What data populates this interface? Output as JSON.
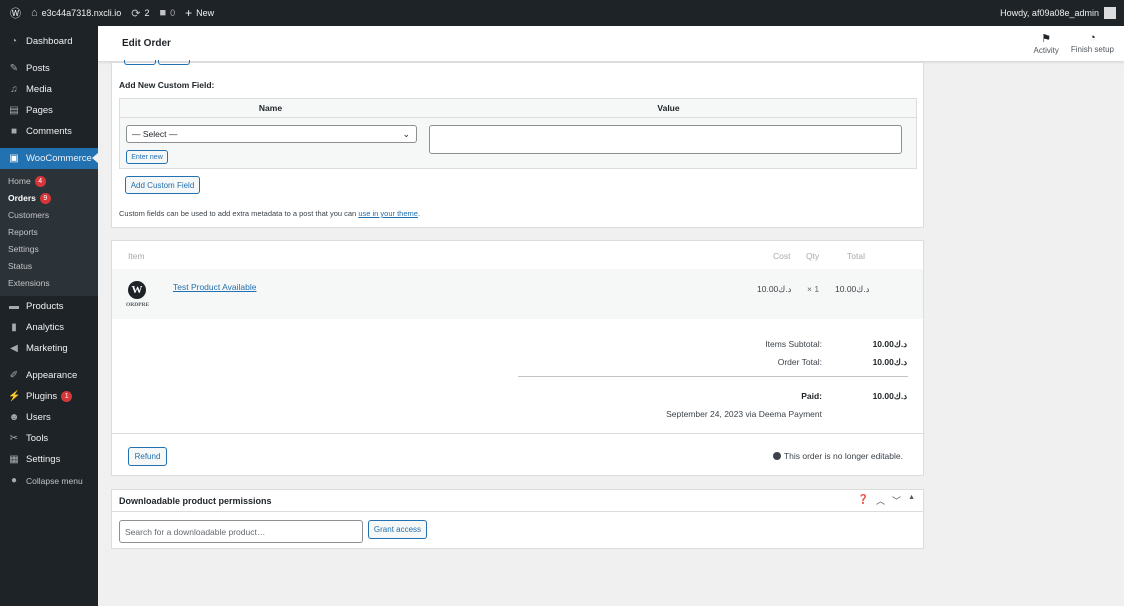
{
  "adminbar": {
    "site": "e3c44a7318.nxcli.io",
    "updates": "2",
    "comments": "0",
    "new": "New",
    "howdy": "Howdy, af09a08e_admin"
  },
  "sidebar": {
    "dashboard": "Dashboard",
    "posts": "Posts",
    "media": "Media",
    "pages": "Pages",
    "comments": "Comments",
    "woocommerce": "WooCommerce",
    "sub": {
      "home": "Home",
      "home_badge": "4",
      "orders": "Orders",
      "orders_badge": "9",
      "customers": "Customers",
      "reports": "Reports",
      "settings": "Settings",
      "status": "Status",
      "extensions": "Extensions"
    },
    "products": "Products",
    "analytics": "Analytics",
    "marketing": "Marketing",
    "appearance": "Appearance",
    "plugins": "Plugins",
    "plugins_badge": "1",
    "users": "Users",
    "tools": "Tools",
    "settings": "Settings",
    "collapse": "Collapse menu"
  },
  "header": {
    "title": "Edit Order",
    "activity": "Activity",
    "finish_setup": "Finish setup"
  },
  "custom_fields": {
    "title": "Add New Custom Field:",
    "col_name": "Name",
    "col_value": "Value",
    "select_value": "— Select —",
    "enter_new": "Enter new",
    "add_button": "Add Custom Field",
    "note_text": "Custom fields can be used to add extra metadata to a post that you can ",
    "note_link": "use in your theme",
    "note_end": "."
  },
  "items": {
    "col_item": "Item",
    "col_cost": "Cost",
    "col_qty": "Qty",
    "col_total": "Total",
    "thumb_caption": "ORDPRE",
    "rows": [
      {
        "name": "Test Product Available",
        "cost": "10.00د.ك",
        "qty": "× 1",
        "total": "10.00د.ك"
      }
    ],
    "subtotal_label": "Items Subtotal:",
    "subtotal_value": "10.00د.ك",
    "order_total_label": "Order Total:",
    "order_total_value": "10.00د.ك",
    "paid_label": "Paid:",
    "paid_value": "10.00د.ك",
    "paid_note": "September 24, 2023 via Deema Payment",
    "refund_button": "Refund",
    "not_editable": "This order is no longer editable."
  },
  "downloads": {
    "title": "Downloadable product permissions",
    "search_placeholder": "Search for a downloadable product…",
    "grant_button": "Grant access"
  }
}
